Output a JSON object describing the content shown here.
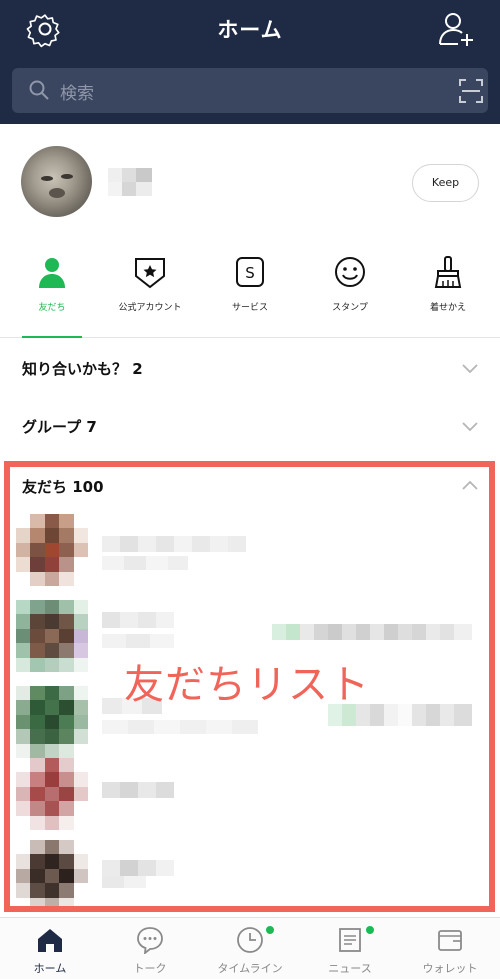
{
  "header": {
    "title": "ホーム",
    "settings_icon": "gear-icon",
    "add_friend_icon": "add-friend-icon"
  },
  "search": {
    "placeholder": "検索",
    "scan_icon": "qr-scan-icon"
  },
  "profile": {
    "keep_label": "Keep"
  },
  "tabs": [
    {
      "label": "友だち",
      "icon": "person-icon",
      "active": true
    },
    {
      "label": "公式アカウント",
      "icon": "shield-star-icon",
      "active": false
    },
    {
      "label": "サービス",
      "icon": "service-s-icon",
      "active": false
    },
    {
      "label": "スタンプ",
      "icon": "smiley-icon",
      "active": false
    },
    {
      "label": "着せかえ",
      "icon": "brush-icon",
      "active": false
    }
  ],
  "sections": {
    "suggestions": "知り合いかも？ 2",
    "groups": "グループ 7",
    "friends": "友だち 100"
  },
  "overlay_text": "友だちリスト",
  "bottom_nav": [
    {
      "label": "ホーム",
      "icon": "home-icon",
      "active": true,
      "badge": false
    },
    {
      "label": "トーク",
      "icon": "chat-icon",
      "active": false,
      "badge": false
    },
    {
      "label": "タイムライン",
      "icon": "clock-icon",
      "active": false,
      "badge": true
    },
    {
      "label": "ニュース",
      "icon": "news-icon",
      "active": false,
      "badge": true
    },
    {
      "label": "ウォレット",
      "icon": "wallet-icon",
      "active": false,
      "badge": false
    }
  ],
  "colors": {
    "header_bg": "#1f2a44",
    "accent_green": "#1eb955",
    "highlight_red": "#f0645a"
  }
}
